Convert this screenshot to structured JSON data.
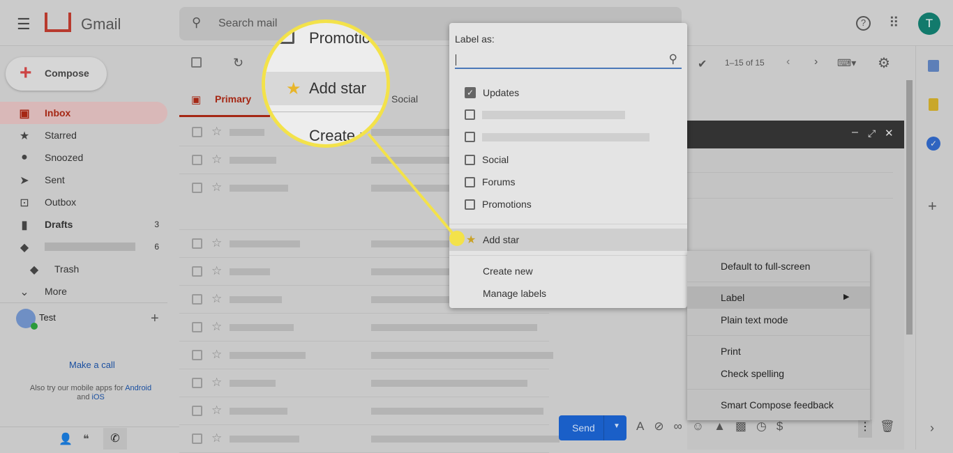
{
  "app": {
    "name": "Gmail",
    "avatar_letter": "T"
  },
  "search": {
    "placeholder": "Search mail"
  },
  "compose_label": "Compose",
  "sidebar": {
    "items": [
      {
        "label": "Inbox",
        "icon": "inbox-icon",
        "count": ""
      },
      {
        "label": "Starred",
        "icon": "star-icon",
        "count": ""
      },
      {
        "label": "Snoozed",
        "icon": "clock-icon",
        "count": ""
      },
      {
        "label": "Sent",
        "icon": "send-icon",
        "count": ""
      },
      {
        "label": "Outbox",
        "icon": "outbox-icon",
        "count": ""
      },
      {
        "label": "Drafts",
        "icon": "draft-icon",
        "count": "3"
      },
      {
        "label": "",
        "icon": "label-icon",
        "count": "6"
      },
      {
        "label": "Trash",
        "icon": "label-icon",
        "count": ""
      },
      {
        "label": "More",
        "icon": "chevron-down-icon",
        "count": ""
      }
    ],
    "user": "Test",
    "make_call": "Make a call",
    "mobile_text": "Also try our mobile apps for",
    "android": "Android",
    "and": "and",
    "ios": "iOS"
  },
  "toolbar": {
    "pagination": "1–15 of 15"
  },
  "tabs": [
    {
      "label": "Primary"
    },
    {
      "label": "Social"
    }
  ],
  "magnifier": {
    "items": [
      "Promotio",
      "Add star",
      "Create n"
    ]
  },
  "label_menu": {
    "title": "Label as:",
    "items": [
      {
        "label": "Updates",
        "checked": true
      },
      {
        "label": "",
        "checked": false
      },
      {
        "label": "",
        "checked": false
      },
      {
        "label": "Social",
        "checked": false
      },
      {
        "label": "Forums",
        "checked": false
      },
      {
        "label": "Promotions",
        "checked": false
      }
    ],
    "add_star": "Add star",
    "create_new": "Create new",
    "manage_labels": "Manage labels"
  },
  "context_menu": {
    "items": [
      "Default to full-screen",
      "Label",
      "Plain text mode",
      "Print",
      "Check spelling",
      "Smart Compose feedback"
    ]
  },
  "send_label": "Send",
  "colors": {
    "highlight": "#f3e24a",
    "accent": "#1a66d0",
    "inbox": "#a52714"
  }
}
